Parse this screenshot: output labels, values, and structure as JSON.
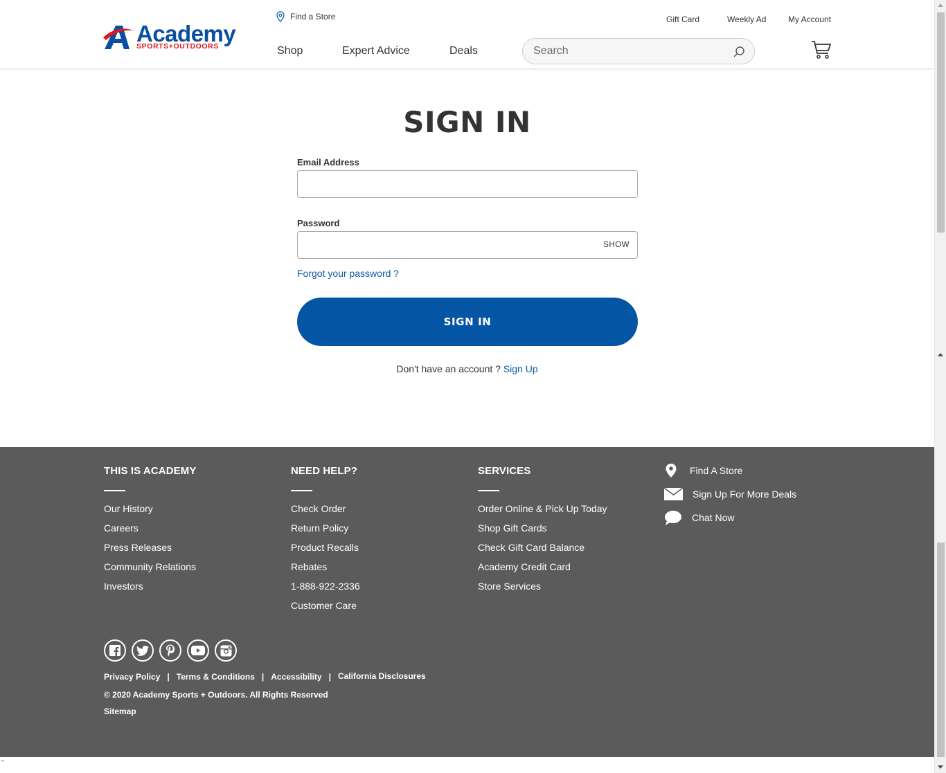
{
  "header": {
    "brand_word": "Academy",
    "brand_tag": "SPORTS+OUTDOORS",
    "find_store": "Find a Store",
    "util_links": [
      "Gift Card",
      "Weekly Ad",
      "My Account"
    ],
    "nav": [
      "Shop",
      "Expert Advice",
      "Deals"
    ],
    "search_placeholder": "Search"
  },
  "main": {
    "title": "SIGN IN",
    "email_label": "Email Address",
    "email_value": "",
    "password_label": "Password",
    "password_value": "",
    "show_label": "SHOW",
    "forgot_link": "Forgot your password ?",
    "signin_button": "SIGN IN",
    "no_account_text": "Don't have an account ?",
    "signup_link": "Sign Up"
  },
  "footer": {
    "columns": [
      {
        "heading": "THIS IS ACADEMY",
        "links": [
          "Our History",
          "Careers",
          "Press Releases",
          "Community Relations",
          "Investors"
        ]
      },
      {
        "heading": "NEED HELP?",
        "links": [
          "Check Order",
          "Return Policy",
          "Product Recalls",
          "Rebates",
          "1-888-922-2336",
          "Customer Care"
        ]
      },
      {
        "heading": "SERVICES",
        "links": [
          "Order Online & Pick Up Today",
          "Shop Gift Cards",
          "Check Gift Card Balance",
          "Academy Credit Card",
          "Store Services"
        ]
      }
    ],
    "aside": [
      "Find A Store",
      "Sign Up For More Deals",
      "Chat Now"
    ],
    "social_icons": [
      "facebook-icon",
      "twitter-icon",
      "pinterest-icon",
      "youtube-icon",
      "instagram-icon"
    ],
    "legal": [
      "Privacy Policy",
      "Terms & Conditions",
      "Accessibility",
      "California Disclosures"
    ],
    "legal_separator": "|",
    "copyright": "© 2020 Academy Sports + Outdoors. All Rights Reserved",
    "sitemap": "Sitemap"
  },
  "colors": {
    "brand_blue": "#0a4ea2",
    "brand_red": "#d61a1f",
    "button_blue": "#0555a5",
    "link_blue": "#0b5aa6",
    "footer_bg": "#5b5b5b"
  },
  "stray_text": "\""
}
